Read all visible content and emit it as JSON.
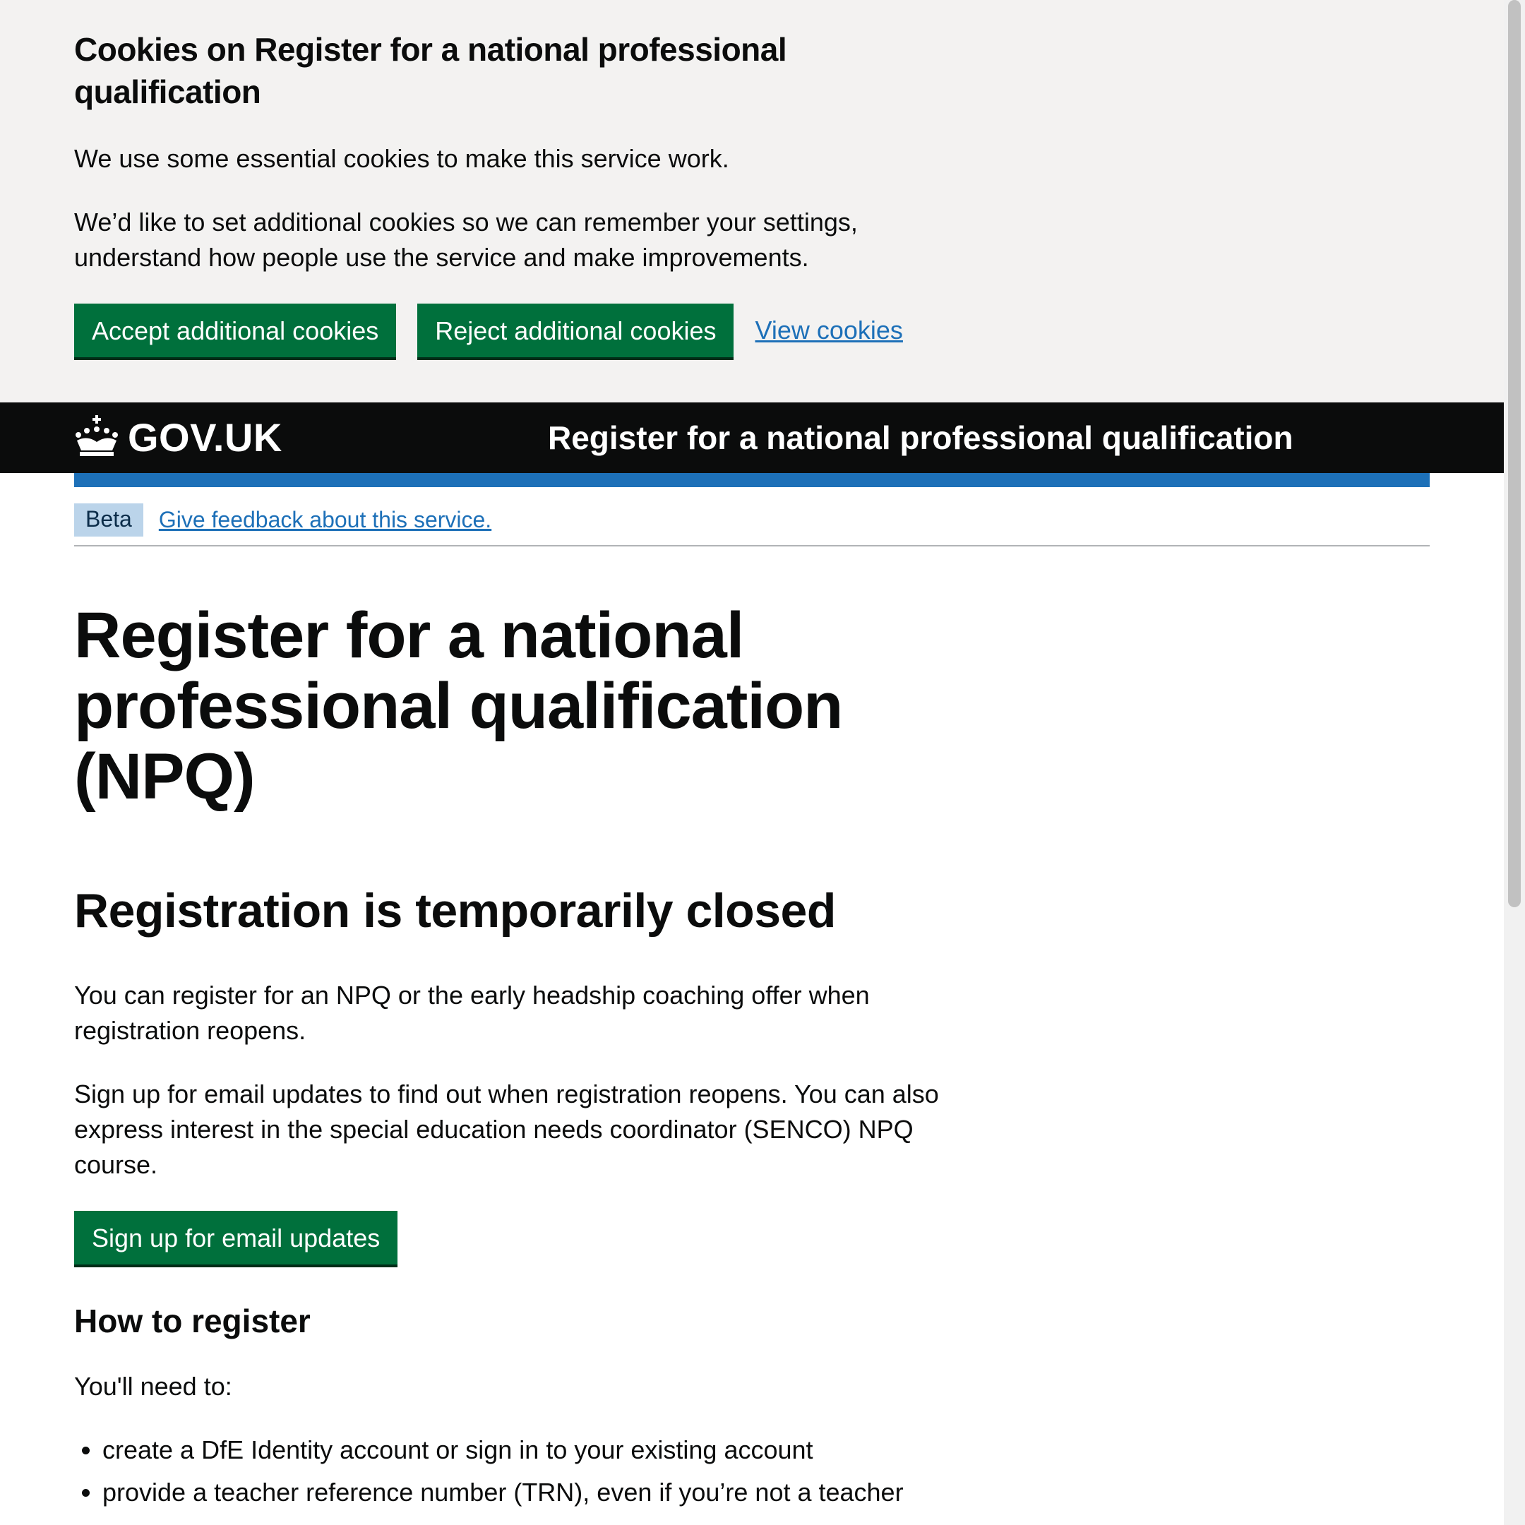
{
  "cookie_banner": {
    "title": "Cookies on Register for a national professional qualification",
    "paragraph1": "We use some essential cookies to make this service work.",
    "paragraph2": "We’d like to set additional cookies so we can remember your settings, understand how people use the service and make improvements.",
    "accept_label": "Accept additional cookies",
    "reject_label": "Reject additional cookies",
    "view_label": "View cookies"
  },
  "header": {
    "logo_text": "GOV.UK",
    "logo_icon": "crown-icon",
    "service_name": "Register for a national professional qualification"
  },
  "phase_banner": {
    "tag": "Beta",
    "feedback_link": "Give feedback about this service."
  },
  "main": {
    "title": "Register for a national professional qualification (NPQ)",
    "subtitle": "Registration is temporarily closed",
    "paragraph1": "You can register for an NPQ or the early headship coaching offer when registration reopens.",
    "paragraph2": "Sign up for email updates to find out when registration reopens. You can also express interest in the special education needs coordinator (SENCO) NPQ course.",
    "signup_label": "Sign up for email updates",
    "how_heading": "How to register",
    "how_intro": "You'll need to:",
    "how_items": [
      "create a DfE Identity account or sign in to your existing account",
      "provide a teacher reference number (TRN), even if you’re not a teacher"
    ]
  },
  "colors": {
    "button_green": "#00703c",
    "link_blue": "#1d70b8",
    "header_black": "#0b0c0c",
    "banner_grey": "#f3f2f1"
  }
}
